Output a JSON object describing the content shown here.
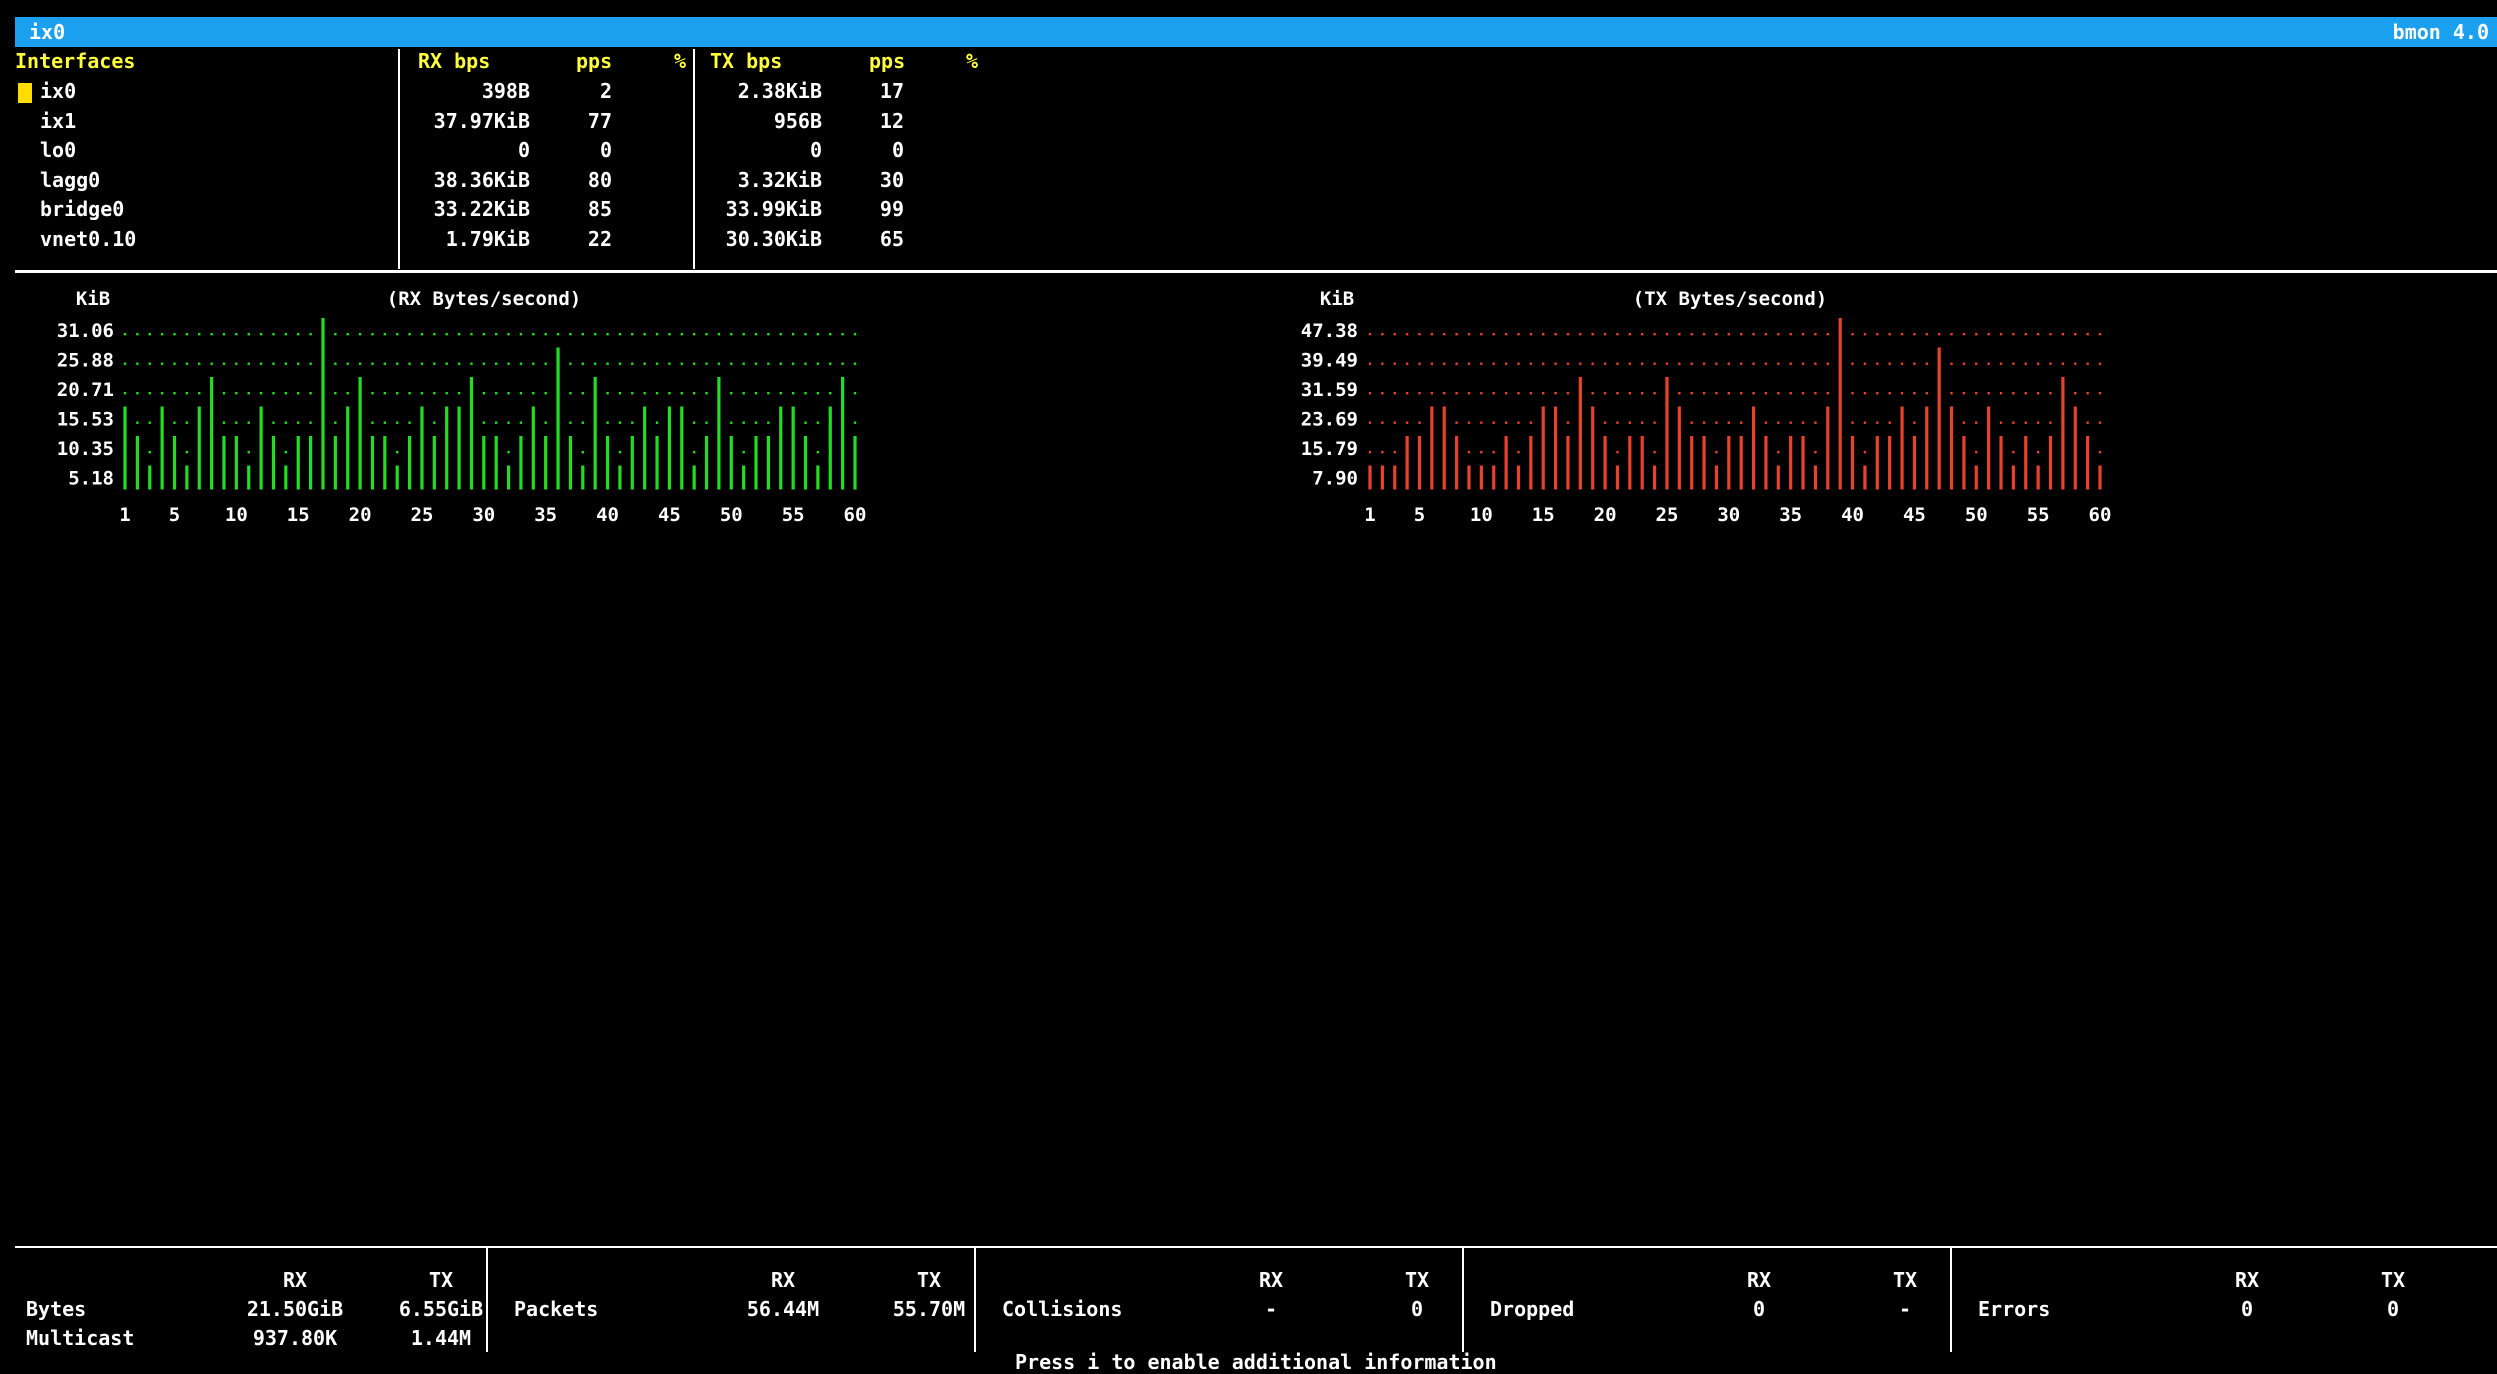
{
  "title_bar": {
    "left": "ix0",
    "right": "bmon 4.0",
    "bg_color": "#1aa0ef"
  },
  "interfaces_table": {
    "headers": {
      "interfaces": "Interfaces",
      "rx_bps": "RX bps",
      "rx_pps": "pps",
      "rx_pct": "%",
      "tx_bps": "TX bps",
      "tx_pps": "pps",
      "tx_pct": "%"
    },
    "selected_index": 0,
    "rows": [
      {
        "name": "ix0",
        "rx_bps": "398B",
        "rx_pps": "2",
        "tx_bps": "2.38KiB",
        "tx_pps": "17"
      },
      {
        "name": "ix1",
        "rx_bps": "37.97KiB",
        "rx_pps": "77",
        "tx_bps": "956B",
        "tx_pps": "12"
      },
      {
        "name": "lo0",
        "rx_bps": "0",
        "rx_pps": "0",
        "tx_bps": "0",
        "tx_pps": "0"
      },
      {
        "name": "lagg0",
        "rx_bps": "38.36KiB",
        "rx_pps": "80",
        "tx_bps": "3.32KiB",
        "tx_pps": "30"
      },
      {
        "name": "bridge0",
        "rx_bps": "33.22KiB",
        "rx_pps": "85",
        "tx_bps": "33.99KiB",
        "tx_pps": "99"
      },
      {
        "name": "vnet0.10",
        "rx_bps": "1.79KiB",
        "rx_pps": "22",
        "tx_bps": "30.30KiB",
        "tx_pps": "65"
      }
    ]
  },
  "chart_data": [
    {
      "type": "bar",
      "title": "(RX Bytes/second)",
      "ylabel": "KiB",
      "color": "#22dd22",
      "y_levels": [
        "31.06",
        "25.88",
        "20.71",
        "15.53",
        "10.35",
        "5.18"
      ],
      "x_ticks": [
        "1",
        "5",
        "10",
        "15",
        "20",
        "25",
        "30",
        "35",
        "40",
        "45",
        "50",
        "55",
        "60"
      ],
      "values": [
        3,
        2,
        1,
        3,
        2,
        1,
        3,
        4,
        2,
        2,
        1,
        3,
        2,
        1,
        2,
        2,
        6,
        2,
        3,
        4,
        2,
        2,
        1,
        2,
        3,
        2,
        3,
        3,
        4,
        2,
        2,
        1,
        2,
        3,
        2,
        5,
        2,
        1,
        4,
        2,
        1,
        2,
        3,
        2,
        3,
        3,
        1,
        2,
        4,
        2,
        1,
        2,
        2,
        3,
        3,
        2,
        1,
        3,
        4,
        2
      ],
      "xlim": [
        1,
        60
      ]
    },
    {
      "type": "bar",
      "title": "(TX Bytes/second)",
      "ylabel": "KiB",
      "color": "#e8412c",
      "y_levels": [
        "47.38",
        "39.49",
        "31.59",
        "23.69",
        "15.79",
        "7.90"
      ],
      "x_ticks": [
        "1",
        "5",
        "10",
        "15",
        "20",
        "25",
        "30",
        "35",
        "40",
        "45",
        "50",
        "55",
        "60"
      ],
      "values": [
        1,
        1,
        1,
        2,
        2,
        3,
        3,
        2,
        1,
        1,
        1,
        2,
        1,
        2,
        3,
        3,
        2,
        4,
        3,
        2,
        1,
        2,
        2,
        1,
        4,
        3,
        2,
        2,
        1,
        2,
        2,
        3,
        2,
        1,
        2,
        2,
        1,
        3,
        6,
        2,
        1,
        2,
        2,
        3,
        2,
        3,
        5,
        3,
        2,
        1,
        3,
        2,
        1,
        2,
        1,
        2,
        4,
        3,
        2,
        1
      ],
      "xlim": [
        1,
        60
      ]
    }
  ],
  "stats_footer": {
    "groups": [
      {
        "rx_label": "RX",
        "tx_label": "TX",
        "rows": [
          {
            "label": "Bytes",
            "rx": "21.50GiB",
            "tx": "6.55GiB"
          },
          {
            "label": "Multicast",
            "rx": "937.80K",
            "tx": "1.44M"
          }
        ]
      },
      {
        "rx_label": "RX",
        "tx_label": "TX",
        "rows": [
          {
            "label": "Packets",
            "rx": "56.44M",
            "tx": "55.70M"
          }
        ]
      },
      {
        "rx_label": "RX",
        "tx_label": "TX",
        "rows": [
          {
            "label": "Collisions",
            "rx": "-",
            "tx": "0"
          }
        ]
      },
      {
        "rx_label": "RX",
        "tx_label": "TX",
        "rows": [
          {
            "label": "Dropped",
            "rx": "0",
            "tx": "-"
          }
        ]
      },
      {
        "rx_label": "RX",
        "tx_label": "TX",
        "rows": [
          {
            "label": "Errors",
            "rx": "0",
            "tx": "0"
          }
        ]
      }
    ],
    "hint": "Press i to enable additional information"
  }
}
